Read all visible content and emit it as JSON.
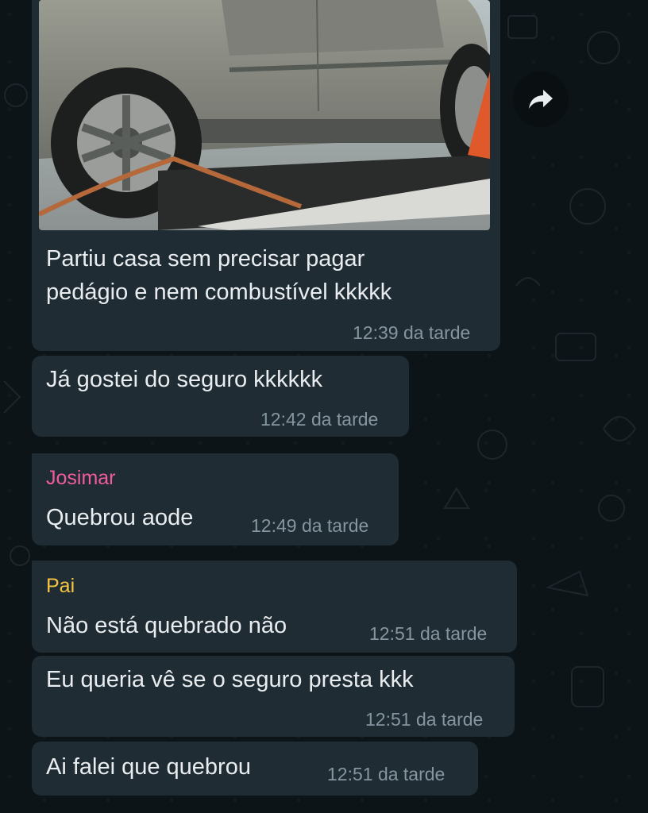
{
  "messages": [
    {
      "id": "m1",
      "text_lines": [
        "Partiu casa sem precisar pagar",
        "pedágio e nem combustível kkkkk"
      ],
      "time": "12:39 da tarde",
      "has_photo": true,
      "photo_description_icon": "towed-car-photo"
    },
    {
      "id": "m2",
      "text": "Já gostei do seguro kkkkkk",
      "time": "12:42 da tarde"
    },
    {
      "id": "m3",
      "sender": "Josimar",
      "sender_color": "#f15c9e",
      "text": "Quebrou aode",
      "time": "12:49 da tarde"
    },
    {
      "id": "m4",
      "sender": "Pai",
      "sender_color": "#f5c542",
      "text": "Não está quebrado não",
      "time": "12:51 da tarde"
    },
    {
      "id": "m5",
      "text": "Eu queria vê se o seguro presta kkk",
      "time": "12:51 da tarde"
    },
    {
      "id": "m6",
      "text": "Ai falei que quebrou",
      "time": "12:51 da tarde"
    }
  ],
  "forward_icon": "forward-icon",
  "colors": {
    "background": "#0d1418",
    "bubble": "#1f2c34",
    "text": "#e9edef",
    "time": "#8696a0"
  }
}
